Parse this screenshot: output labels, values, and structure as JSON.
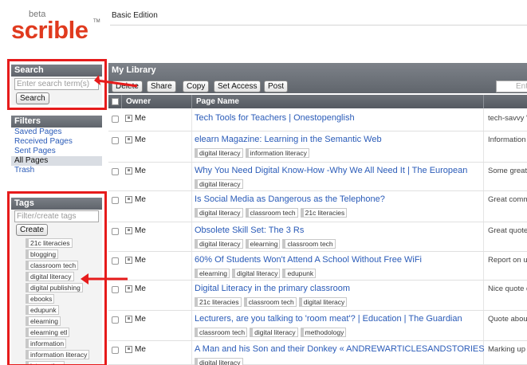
{
  "logo": {
    "beta": "beta",
    "name": "scrible",
    "tm": "TM"
  },
  "edition": "Basic Edition",
  "search": {
    "title": "Search",
    "placeholder": "Enter search term(s)",
    "button": "Search"
  },
  "filters": {
    "title": "Filters",
    "items": [
      {
        "label": "Saved Pages"
      },
      {
        "label": "Received Pages"
      },
      {
        "label": "Sent Pages"
      },
      {
        "label": "All Pages"
      },
      {
        "label": "Trash"
      }
    ]
  },
  "tags": {
    "title": "Tags",
    "placeholder": "Filter/create tags",
    "button": "Create",
    "items": [
      "21c literacies",
      "blogging",
      "classroom tech",
      "digital literacy",
      "digital publishing",
      "ebooks",
      "edupunk",
      "elearning",
      "elearning etl",
      "information",
      "information literacy",
      "integration"
    ]
  },
  "library": {
    "title": "My Library",
    "toolbar": {
      "delete": "Delete",
      "share": "Share",
      "copy": "Copy",
      "set_access": "Set Access",
      "post": "Post"
    },
    "search_placeholder": "Ente",
    "columns": {
      "owner": "Owner",
      "page_name": "Page Name"
    },
    "rows": [
      {
        "owner": "Me",
        "title": "Tech Tools for Teachers | Onestopenglish",
        "desc": "tech-savvy \"i",
        "tags": []
      },
      {
        "owner": "Me",
        "title": "elearn Magazine: Learning in the Semantic Web",
        "desc": "Information l",
        "tags": [
          "digital literacy",
          "information literacy"
        ]
      },
      {
        "owner": "Me",
        "title": "Why You Need Digital Know-How -Why We All Need It | The European",
        "desc": "Some great c",
        "tags": [
          "digital literacy"
        ]
      },
      {
        "owner": "Me",
        "title": "Is Social Media as Dangerous as the Telephone?",
        "desc": "Great comm",
        "tags": [
          "digital literacy",
          "classroom tech",
          "21c literacies"
        ]
      },
      {
        "owner": "Me",
        "title": "Obsolete Skill Set: The 3 Rs",
        "desc": "Great quote",
        "tags": [
          "digital literacy",
          "elearning",
          "classroom tech"
        ]
      },
      {
        "owner": "Me",
        "title": "60% Of Students Won't Attend A School Without Free WiFi",
        "desc": "Report on us",
        "tags": [
          "elearning",
          "digital literacy",
          "edupunk"
        ]
      },
      {
        "owner": "Me",
        "title": "Digital Literacy in the primary classroom",
        "desc": "Nice quote d",
        "tags": [
          "21c literacies",
          "classroom tech",
          "digital literacy"
        ]
      },
      {
        "owner": "Me",
        "title": "Lecturers, are you talking to 'room meat'? | Education | The Guardian",
        "desc": "Quote about",
        "tags": [
          "classroom tech",
          "digital literacy",
          "methodology"
        ]
      },
      {
        "owner": "Me",
        "title": "A Man and his Son and their Donkey « ANDREWARTICLESANDSTORIES",
        "desc": "Marking up a",
        "tags": [
          "digital literacy"
        ]
      }
    ]
  },
  "colors": {
    "annotation_red": "#e61b1b",
    "link_blue": "#2a5bb8",
    "brand_red": "#e03a1e"
  }
}
